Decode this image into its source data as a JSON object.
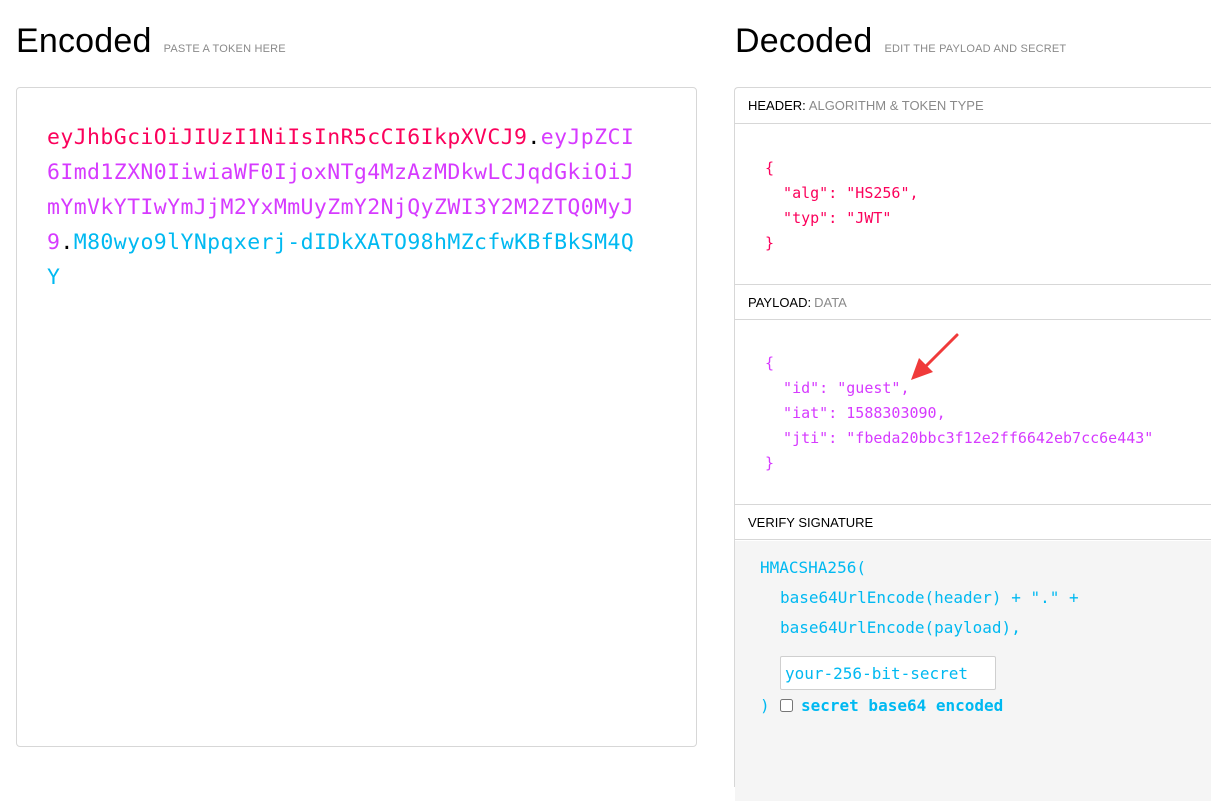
{
  "encoded": {
    "title": "Encoded",
    "subtitle": "PASTE A TOKEN HERE",
    "token": {
      "header": "eyJhbGciOiJIUzI1NiIsInR5cCI6IkpXVCJ9",
      "payload": "eyJpZCI6Imd1ZXN0IiwiaWF0IjoxNTg4MzAzMDkwLCJqdGkiOiJmYmVkYTIwYmJjM2YxMmUyZmY2NjQyZWI3Y2M2ZTQ0MyJ9",
      "signature": "M80wyo9lYNpqxerj-dIDkXATO98hMZcfwKBfBkSM4QY",
      "separator": "."
    }
  },
  "decoded": {
    "title": "Decoded",
    "subtitle": "EDIT THE PAYLOAD AND SECRET",
    "header_section": {
      "label": "HEADER:",
      "desc": "ALGORITHM & TOKEN TYPE",
      "json": "{\n  \"alg\": \"HS256\",\n  \"typ\": \"JWT\"\n}"
    },
    "payload_section": {
      "label": "PAYLOAD:",
      "desc": "DATA",
      "json": "{\n  \"id\": \"guest\",\n  \"iat\": 1588303090,\n  \"jti\": \"fbeda20bbc3f12e2ff6642eb7cc6e443\"\n}"
    },
    "verify_section": {
      "label": "VERIFY SIGNATURE",
      "line1": "HMACSHA256(",
      "line2": "base64UrlEncode(header) + \".\" +",
      "line3": "base64UrlEncode(payload),",
      "secret_placeholder": "your-256-bit-secret",
      "close": ")",
      "base64_label": "secret base64 encoded"
    }
  },
  "colors": {
    "header": "#fb015b",
    "payload": "#d63aff",
    "signature": "#00b9f1",
    "annotation": "#f03a3a"
  }
}
